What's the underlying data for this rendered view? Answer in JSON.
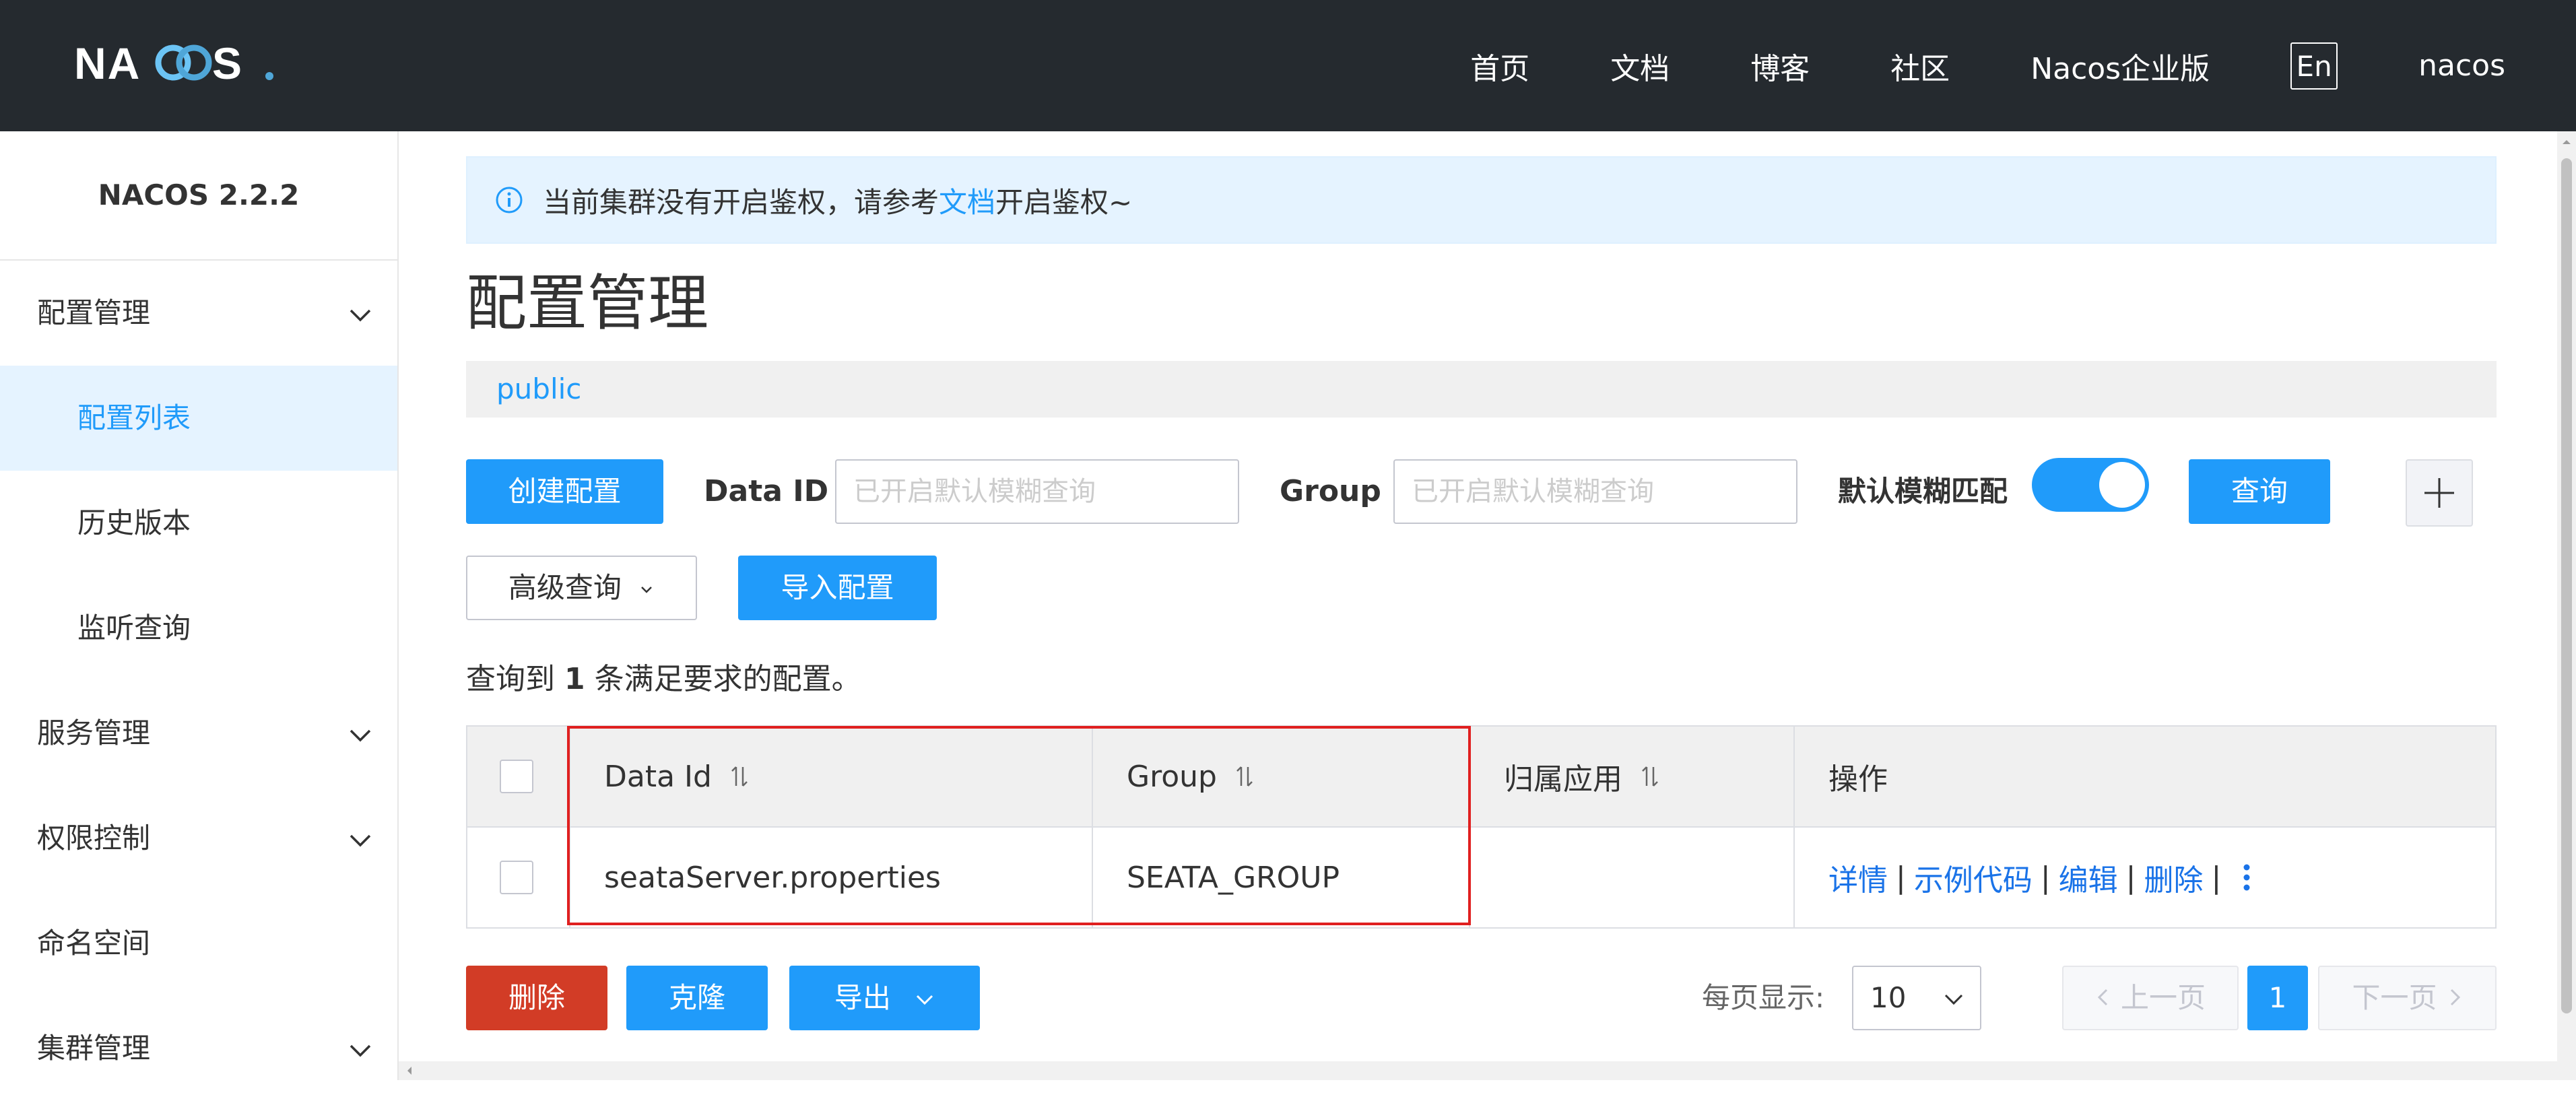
{
  "header": {
    "logo": "NACOS.",
    "nav": [
      "首页",
      "文档",
      "博客",
      "社区",
      "Nacos企业版"
    ],
    "lang": "En",
    "user": "nacos"
  },
  "sidebar": {
    "version": "NACOS 2.2.2",
    "items": [
      {
        "label": "配置管理",
        "type": "group",
        "expanded": true
      },
      {
        "label": "配置列表",
        "type": "sub",
        "active": true
      },
      {
        "label": "历史版本",
        "type": "sub"
      },
      {
        "label": "监听查询",
        "type": "sub"
      },
      {
        "label": "服务管理",
        "type": "group"
      },
      {
        "label": "权限控制",
        "type": "group"
      },
      {
        "label": "命名空间",
        "type": "item"
      },
      {
        "label": "集群管理",
        "type": "group"
      }
    ]
  },
  "notice": {
    "prefix": "当前集群没有开启鉴权，请参考",
    "link": "文档",
    "suffix": "开启鉴权~"
  },
  "page": {
    "title": "配置管理",
    "namespace": "public"
  },
  "toolbar": {
    "create_label": "创建配置",
    "dataid_label": "Data ID",
    "dataid_placeholder": "已开启默认模糊查询",
    "group_label": "Group",
    "group_placeholder": "已开启默认模糊查询",
    "fuzzy_label": "默认模糊匹配",
    "fuzzy_on": true,
    "query_label": "查询",
    "plus_label": "+",
    "advanced_label": "高级查询",
    "import_label": "导入配置"
  },
  "result": {
    "prefix": "查询到",
    "count": "1",
    "suffix": "条满足要求的配置。"
  },
  "table": {
    "columns": [
      "Data Id",
      "Group",
      "归属应用",
      "操作"
    ],
    "rows": [
      {
        "data_id": "seataServer.properties",
        "group": "SEATA_GROUP",
        "app": ""
      }
    ],
    "ops": [
      "详情",
      "示例代码",
      "编辑",
      "删除"
    ],
    "separator": "|"
  },
  "footer": {
    "delete_label": "删除",
    "clone_label": "克隆",
    "export_label": "导出",
    "page_size_label": "每页显示:",
    "page_size": "10",
    "prev_label": "上一页",
    "current_page": "1",
    "next_label": "下一页"
  },
  "colors": {
    "primary": "#209bfa",
    "danger": "#d23c26",
    "header_bg": "#252a2f",
    "highlight": "#e02020"
  }
}
